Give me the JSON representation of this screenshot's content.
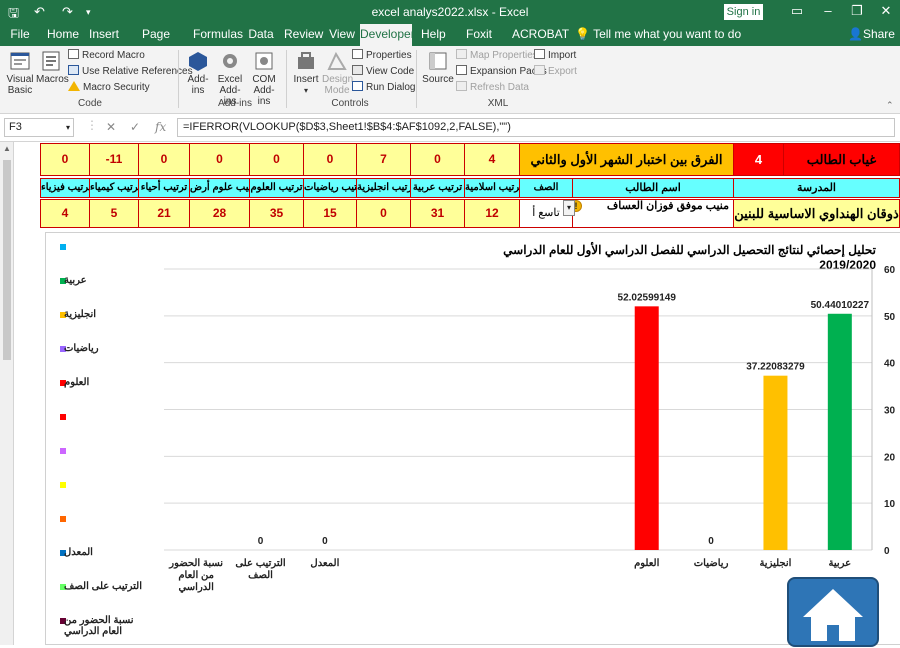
{
  "window": {
    "title": "excel analys2022.xlsx  -  Excel",
    "sign_in": "Sign in"
  },
  "tabs": [
    "File",
    "Home",
    "Insert",
    "Page Layout",
    "Formulas",
    "Data",
    "Review",
    "View",
    "Developer",
    "Help",
    "Foxit PDF",
    "ACROBAT"
  ],
  "active_tab": "Developer",
  "tell_me": "Tell me what you want to do",
  "share": "Share",
  "ribbon": {
    "code": {
      "visual_basic": "Visual Basic",
      "macros": "Macros",
      "record_macro": "Record Macro",
      "relative_refs": "Use Relative References",
      "macro_security": "Macro Security",
      "group": "Code"
    },
    "addins": {
      "addins": "Add-ins",
      "excel_addins": "Excel Add-ins",
      "com_addins": "COM Add-ins",
      "group": "Add-ins"
    },
    "controls": {
      "insert": "Insert",
      "design_mode": "Design Mode",
      "properties": "Properties",
      "view_code": "View Code",
      "run_dialog": "Run Dialog",
      "group": "Controls"
    },
    "xml": {
      "source": "Source",
      "map_properties": "Map Properties",
      "expansion_packs": "Expansion Packs",
      "refresh_data": "Refresh Data",
      "import": "Import",
      "export": "Export",
      "group": "XML"
    }
  },
  "formula_bar": {
    "cell_ref": "F3",
    "formula": "=IFERROR(VLOOKUP($D$3,Sheet1!$B$4:$AF$1092,2,FALSE),\"\")"
  },
  "sheet": {
    "row1": {
      "absence_label": "غياب الطالب",
      "absence_value": "4",
      "diff_label": "الفرق بين اختبار الشهر الأول والثاني",
      "diff_values": [
        "4",
        "0",
        "7",
        "0",
        "0",
        "0",
        "0",
        "-11",
        "0"
      ]
    },
    "row2": {
      "school_header": "المدرسة",
      "student_header": "اسم الطالب",
      "class_header": "الصف",
      "rank_headers": [
        "ترتيب اسلامية",
        "ترتيب عربية",
        "ترتيب انجليزية",
        "ترتيب رياضيات",
        "ترتيب العلوم",
        "ترتيب علوم أرض",
        "ترتيب أحياء",
        "ترتيب كيمياء",
        "ترتيب فيزياء"
      ]
    },
    "row3": {
      "school": "ذوقان الهنداوي الاساسية للبنين",
      "student": "منيب موفق فوزان العساف",
      "class": "تاسع أ",
      "rank_values": [
        "12",
        "31",
        "0",
        "15",
        "35",
        "28",
        "21",
        "5",
        "4"
      ]
    }
  },
  "chart_data": {
    "type": "bar",
    "title": "تحليل إحصائي لنتائج التحصيل الدراسي  للفصل الدراسي الأول للعام الدراسي 2019/2020",
    "categories": [
      "عربية",
      "انجليزية",
      "رياضيات",
      "العلوم",
      "",
      "",
      "",
      "",
      "المعدل",
      "الترتيب على الصف",
      "نسبة الحضور من العام الدراسي"
    ],
    "series": [
      {
        "name": "عربية",
        "color": "#00b050",
        "values": [
          50.44010227,
          null,
          null,
          null,
          null,
          null,
          null,
          null,
          null,
          null,
          null
        ]
      },
      {
        "name": "انجليزية",
        "color": "#ffc000",
        "values": [
          null,
          37.22083279,
          null,
          null,
          null,
          null,
          null,
          null,
          null,
          null,
          null
        ]
      },
      {
        "name": "رياضيات",
        "color": "#9966ff",
        "values": [
          null,
          null,
          0,
          null,
          null,
          null,
          null,
          null,
          null,
          null,
          null
        ]
      },
      {
        "name": "العلوم",
        "color": "#ff0000",
        "values": [
          null,
          null,
          null,
          52.02599149,
          null,
          null,
          null,
          null,
          null,
          null,
          null
        ]
      },
      {
        "name": "",
        "color": "#ff0000",
        "values": []
      },
      {
        "name": "",
        "color": "#cc66ff",
        "values": []
      },
      {
        "name": "",
        "color": "#ffff00",
        "values": []
      },
      {
        "name": "",
        "color": "#ff6600",
        "values": []
      },
      {
        "name": "المعدل",
        "color": "#0070c0",
        "values": [
          null,
          null,
          null,
          null,
          null,
          null,
          null,
          null,
          0,
          null,
          null
        ]
      },
      {
        "name": "الترتيب على الصف",
        "color": "#66ff66",
        "values": [
          null,
          null,
          null,
          null,
          null,
          null,
          null,
          null,
          null,
          0,
          null
        ]
      },
      {
        "name": "نسبة الحضور من العام الدراسي",
        "color": "#660033",
        "values": [
          null,
          null,
          null,
          null,
          null,
          null,
          null,
          null,
          null,
          null,
          null
        ]
      }
    ],
    "data_labels": [
      "50.44010227",
      "37.22083279",
      "0",
      "52.02599149",
      "0",
      "0"
    ],
    "y_axis": {
      "min": 0,
      "max": 60,
      "ticks": [
        "60",
        "50",
        "40",
        "30",
        "20",
        "10",
        "0"
      ],
      "position": "right"
    },
    "legend": [
      {
        "label": "",
        "color": "#00b0f0"
      },
      {
        "label": "عربية",
        "color": "#00b050"
      },
      {
        "label": "انجليزية",
        "color": "#ffc000"
      },
      {
        "label": "رياضيات",
        "color": "#9966ff"
      },
      {
        "label": "العلوم",
        "color": "#ff0000"
      },
      {
        "label": "",
        "color": "#ff0000"
      },
      {
        "label": "",
        "color": "#cc66ff"
      },
      {
        "label": "",
        "color": "#ffff00"
      },
      {
        "label": "",
        "color": "#ff6600"
      },
      {
        "label": "المعدل",
        "color": "#0070c0"
      },
      {
        "label": "الترتيب على الصف",
        "color": "#66ff66"
      },
      {
        "label": "نسبة الحضور من العام الدراسي",
        "color": "#660033"
      }
    ],
    "legend_position": "left",
    "grid": true
  }
}
